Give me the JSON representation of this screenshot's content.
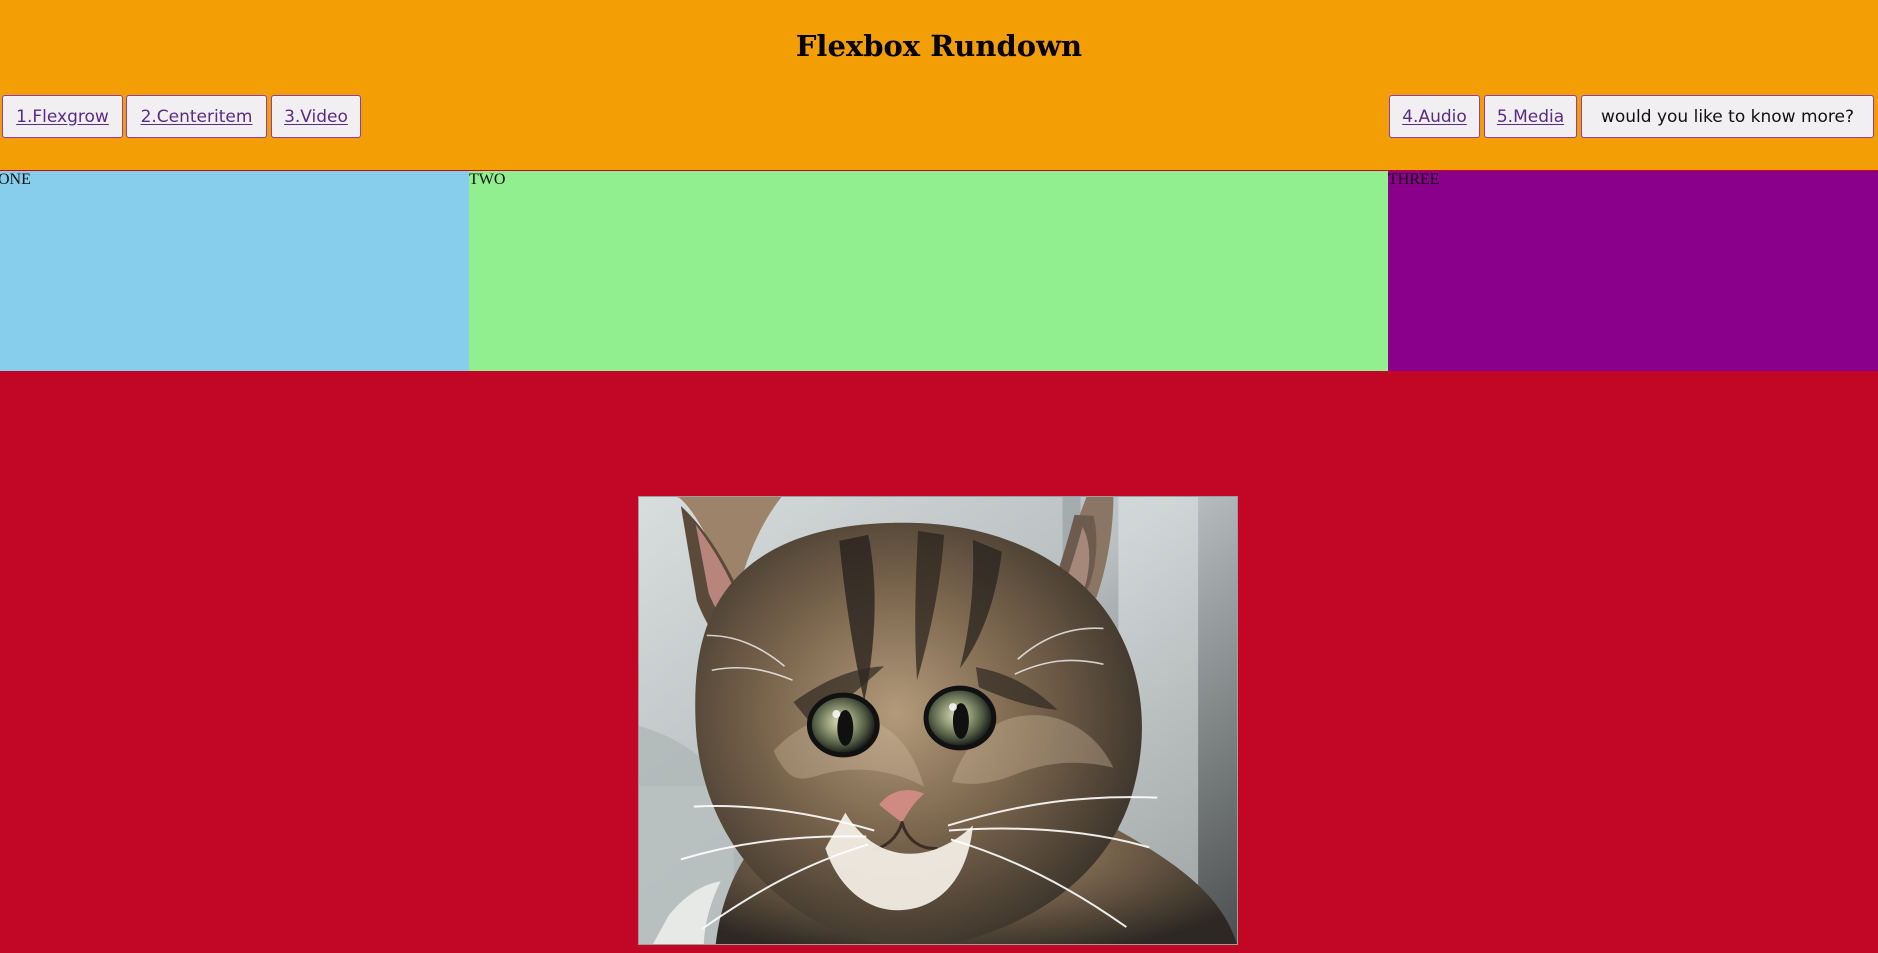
{
  "header": {
    "title": "Flexbox Rundown",
    "background_color": "#f29e04",
    "left_nav": [
      {
        "label": "1.Flexgrow"
      },
      {
        "label": "2.Centeritem"
      },
      {
        "label": "3.Video"
      }
    ],
    "right_nav": [
      {
        "label": "4.Audio"
      },
      {
        "label": "5.Media"
      },
      {
        "label": "would you like to know more?"
      }
    ]
  },
  "flex_boxes": [
    {
      "label": "ONE",
      "color": "#86ceeb"
    },
    {
      "label": "TWO",
      "color": "#91ef8f"
    },
    {
      "label": "THREE",
      "color": "#8b008b"
    }
  ],
  "media": {
    "background_color": "#c20626",
    "image_icon": "kitten-photo"
  }
}
